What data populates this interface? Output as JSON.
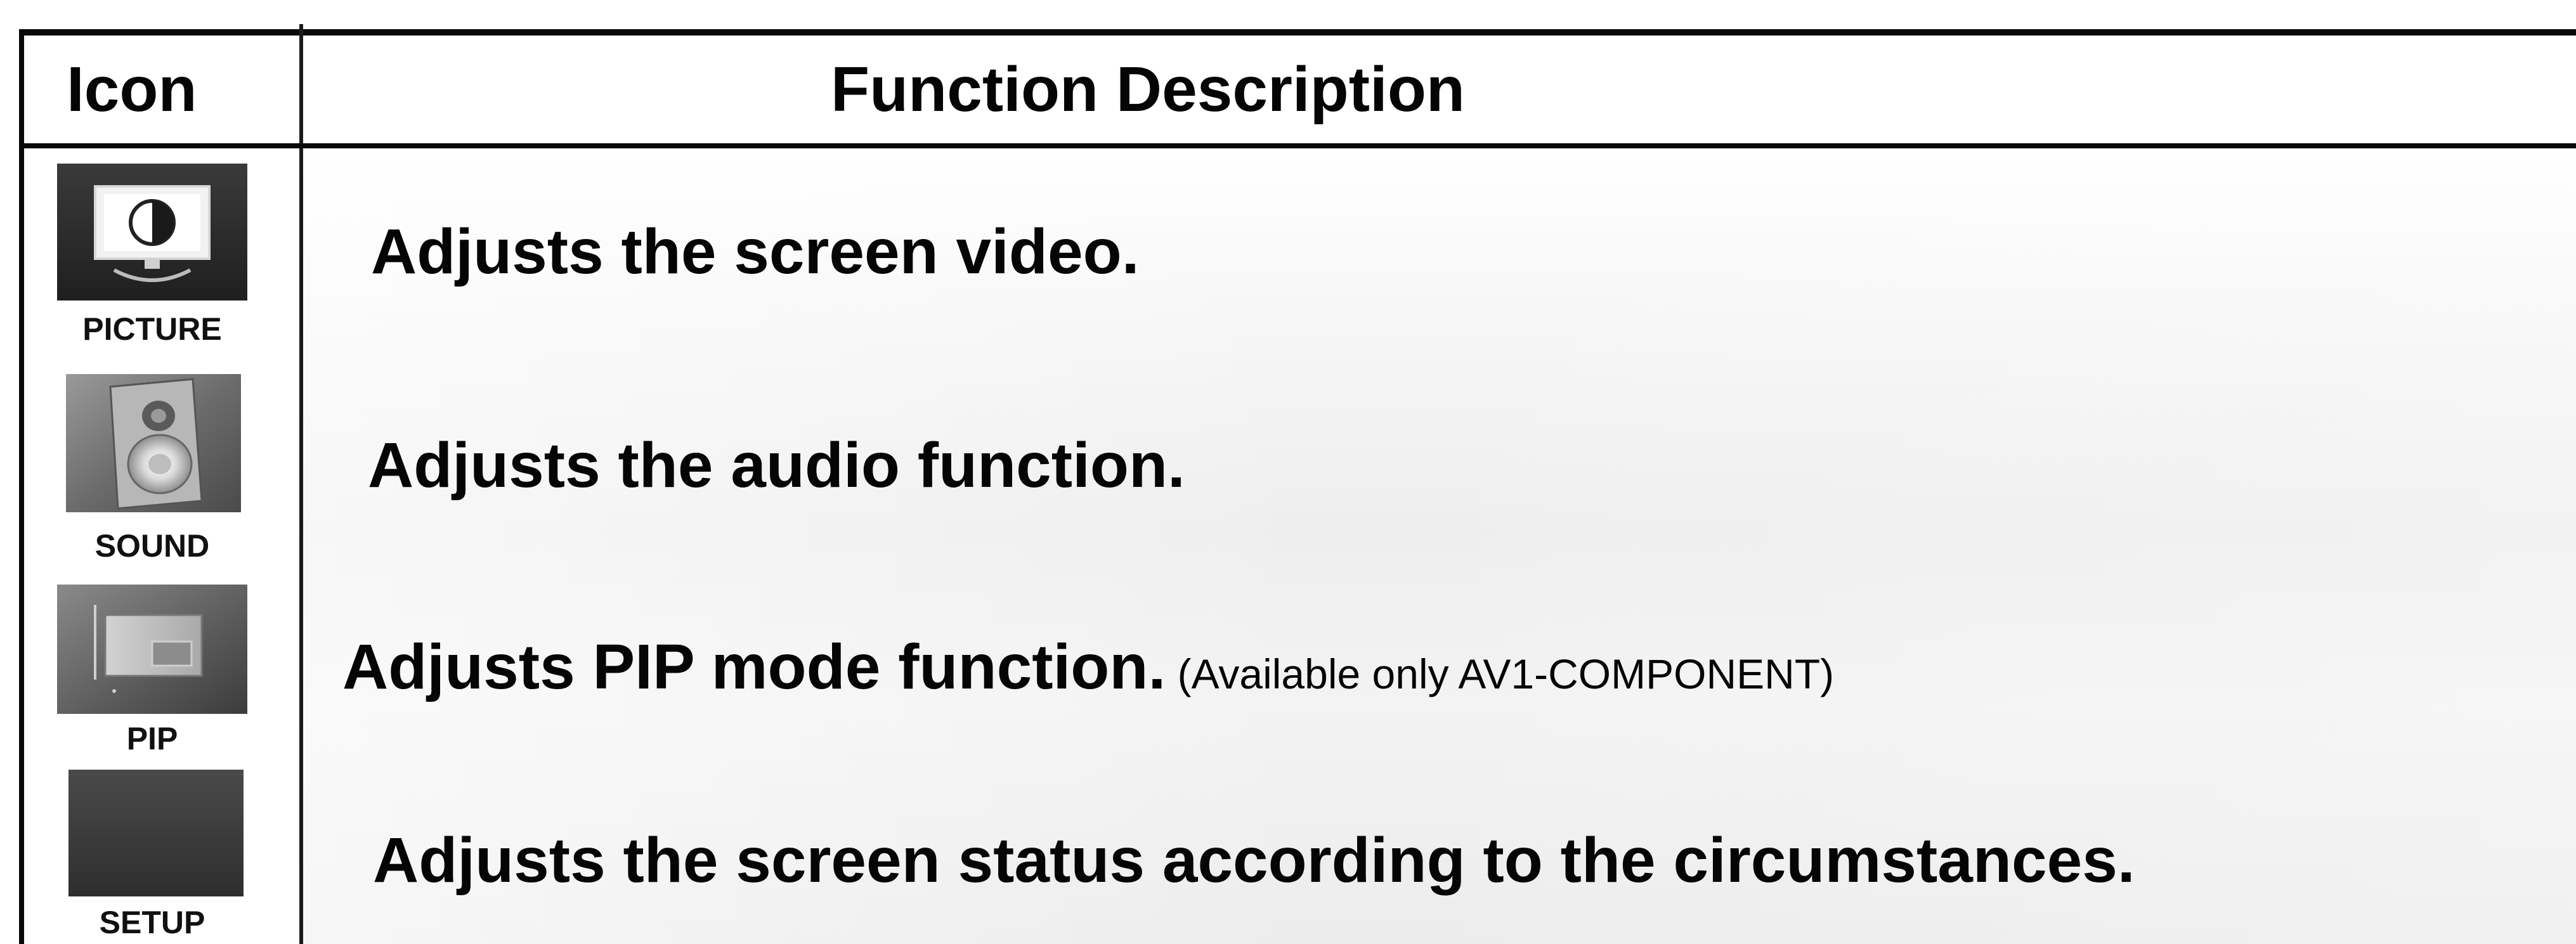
{
  "header": {
    "icon_col": "Icon",
    "desc_col": "Function Description"
  },
  "rows": [
    {
      "icon": "picture-monitor-icon",
      "label": "PICTURE",
      "description": "Adjusts the screen video.",
      "note": ""
    },
    {
      "icon": "sound-speaker-icon",
      "label": "SOUND",
      "description": "Adjusts the audio function.",
      "note": ""
    },
    {
      "icon": "pip-window-icon",
      "label": "PIP",
      "description": "Adjusts PIP mode function.",
      "note": " (Available only AV1-COMPONENT)"
    },
    {
      "icon": "setup-icon",
      "label": "SETUP",
      "description": "Adjusts the screen status according to the circumstances.",
      "note": ""
    }
  ],
  "colors": {
    "border": "#0a0a0a",
    "text": "#050505",
    "icon_dark": "#2c2c2c",
    "icon_gray": "#6f6f6f"
  }
}
